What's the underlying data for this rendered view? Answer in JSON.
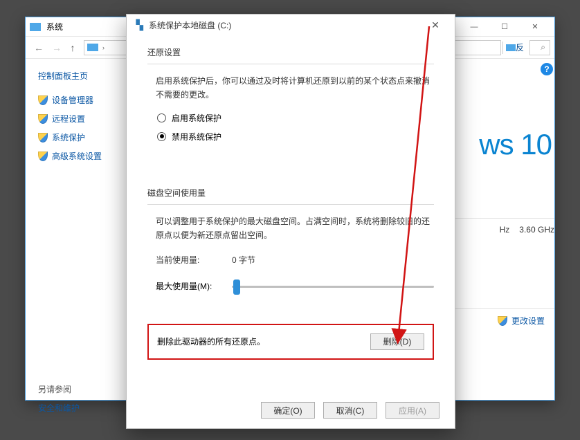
{
  "bg": {
    "title": "系统",
    "winbtns": {
      "min": "—",
      "max": "☐",
      "close": "✕"
    },
    "nav": {
      "back": "←",
      "fwd": "→",
      "up": "↑",
      "addr_seg2_partial": "反",
      "search_icon": "⌕"
    },
    "side": {
      "home": "控制面板主页",
      "items": [
        "设备管理器",
        "远程设置",
        "系统保护",
        "高级系统设置"
      ],
      "see": "另请参阅",
      "bottom": "安全和维护"
    },
    "main": {
      "help": "?",
      "brand": "ws 10",
      "sys_hz": "Hz",
      "sys_ghz": "3.60 GHz",
      "change": "更改设置"
    }
  },
  "dlg": {
    "icon": "▝▖",
    "title": "系统保护本地磁盘 (C:)",
    "close": "✕",
    "sect1": "还原设置",
    "desc1": "启用系统保护后，你可以通过及时将计算机还原到以前的某个状态点来撤消不需要的更改。",
    "radio_on": "启用系统保护",
    "radio_off": "禁用系统保护",
    "sect2": "磁盘空间使用量",
    "desc2": "可以调整用于系统保护的最大磁盘空间。占满空间时，系统将删除较旧的还原点以便为新还原点留出空间。",
    "cur_label": "当前使用量:",
    "cur_value": "0 字节",
    "max_label": "最大使用量(M):",
    "del_text": "删除此驱动器的所有还原点。",
    "del_btn": "删除(D)",
    "ok": "确定(O)",
    "cancel": "取消(C)",
    "apply": "应用(A)"
  }
}
